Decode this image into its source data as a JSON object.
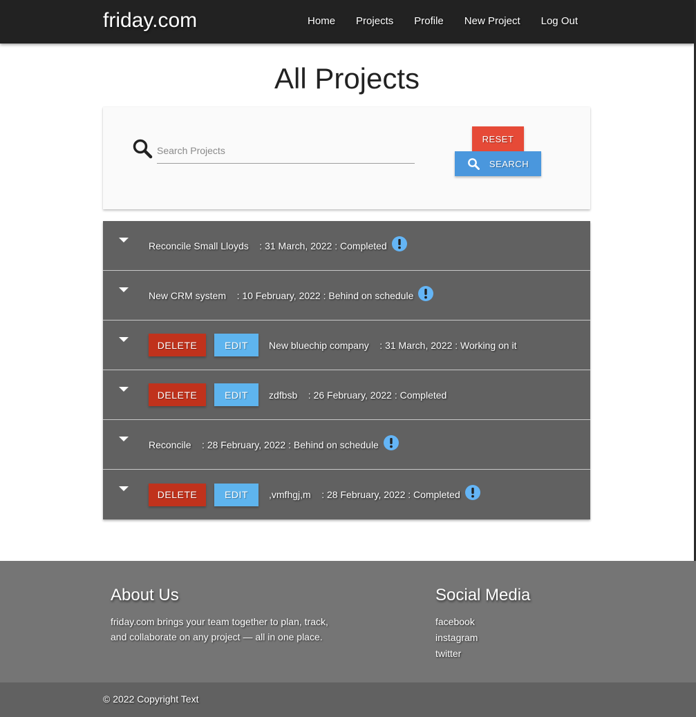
{
  "nav": {
    "brand": "friday.com",
    "links": [
      "Home",
      "Projects",
      "Profile",
      "New Project",
      "Log Out"
    ]
  },
  "page_title": "All Projects",
  "search": {
    "placeholder": "Search Projects",
    "value": "",
    "reset_label": "RESET",
    "search_label": "SEARCH"
  },
  "projects": [
    {
      "text": "Reconcile Small Lloyds    : 31 March, 2022 : Completed",
      "owner_actions": false,
      "alert": true
    },
    {
      "text": "New CRM system    : 10 February, 2022 : Behind on schedule",
      "owner_actions": false,
      "alert": true
    },
    {
      "text": "New bluechip company    : 31 March, 2022 : Working on it",
      "owner_actions": true,
      "alert": false
    },
    {
      "text": "zdfbsb    : 26 February, 2022 : Completed",
      "owner_actions": true,
      "alert": false
    },
    {
      "text": "Reconcile    : 28 February, 2022 : Behind on schedule",
      "owner_actions": false,
      "alert": true
    },
    {
      "text": ",vmfhgj,m    : 28 February, 2022 : Completed",
      "owner_actions": true,
      "alert": true
    }
  ],
  "row_actions": {
    "delete_label": "DELETE",
    "edit_label": "EDIT"
  },
  "colors": {
    "nav_bg": "#222222",
    "row_bg": "#616161",
    "reset": "#e64a37",
    "search": "#4a97dd",
    "delete": "#c0321c",
    "edit": "#5eb4ee",
    "alert": "#64b5f6",
    "footer": "#757575"
  },
  "icons": {
    "row_toggle": "caret-down-icon",
    "status": "alert-circle-icon",
    "search": "search-icon"
  },
  "footer": {
    "about_title": "About Us",
    "about_line1": "friday.com brings your team together to plan, track,",
    "about_line2": "and collaborate on any project — all in one place.",
    "social_title": "Social Media",
    "social_links": [
      "facebook",
      "instagram",
      "twitter"
    ],
    "copyright": "© 2022 Copyright Text"
  }
}
